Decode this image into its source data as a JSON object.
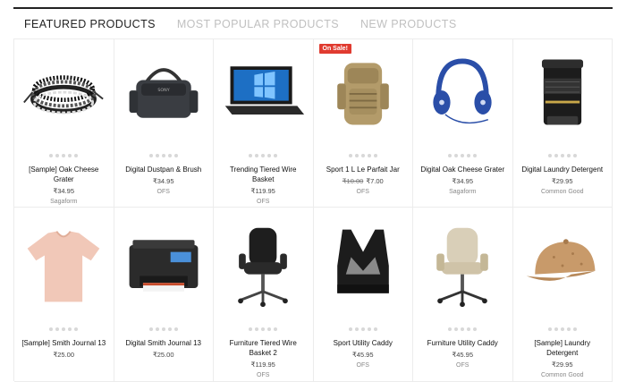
{
  "tabs": [
    {
      "label": "FEATURED PRODUCTS",
      "active": true
    },
    {
      "label": "MOST POPULAR PRODUCTS",
      "active": false
    },
    {
      "label": "NEW PRODUCTS",
      "active": false
    }
  ],
  "products": [
    {
      "title": "[Sample] Oak Cheese Grater",
      "price": "₹34.95",
      "old_price": "",
      "brand": "Sagaform",
      "badge": "",
      "icon": "bracelet-icon"
    },
    {
      "title": "Digital Dustpan & Brush",
      "price": "₹34.95",
      "old_price": "",
      "brand": "OFS",
      "badge": "",
      "icon": "camera-bag-icon"
    },
    {
      "title": "Trending Tiered Wire Basket",
      "price": "₹119.95",
      "old_price": "",
      "brand": "OFS",
      "badge": "",
      "icon": "laptop-icon"
    },
    {
      "title": "Sport 1 L Le Parfait Jar",
      "price": "₹7.00",
      "old_price": "₹10.00",
      "brand": "OFS",
      "badge": "On Sale!",
      "icon": "backpack-icon"
    },
    {
      "title": "Digital Oak Cheese Grater",
      "price": "₹34.95",
      "old_price": "",
      "brand": "Sagaform",
      "badge": "",
      "icon": "headphones-icon"
    },
    {
      "title": "Digital Laundry Detergent",
      "price": "₹29.95",
      "old_price": "",
      "brand": "Common Good",
      "badge": "",
      "icon": "camera-lens-icon"
    },
    {
      "title": "[Sample] Smith Journal 13",
      "price": "₹25.00",
      "old_price": "",
      "brand": "",
      "badge": "",
      "icon": "tshirt-icon"
    },
    {
      "title": "Digital Smith Journal 13",
      "price": "₹25.00",
      "old_price": "",
      "brand": "",
      "badge": "",
      "icon": "printer-icon"
    },
    {
      "title": "Furniture Tiered Wire Basket 2",
      "price": "₹119.95",
      "old_price": "",
      "brand": "OFS",
      "badge": "",
      "icon": "office-chair-black-icon"
    },
    {
      "title": "Sport Utility Caddy",
      "price": "₹45.95",
      "old_price": "",
      "brand": "OFS",
      "badge": "",
      "icon": "sports-bra-icon"
    },
    {
      "title": "Furniture Utility Caddy",
      "price": "₹45.95",
      "old_price": "",
      "brand": "OFS",
      "badge": "",
      "icon": "office-chair-beige-icon"
    },
    {
      "title": "[Sample] Laundry Detergent",
      "price": "₹29.95",
      "old_price": "",
      "brand": "Common Good",
      "badge": "",
      "icon": "cap-icon"
    }
  ]
}
